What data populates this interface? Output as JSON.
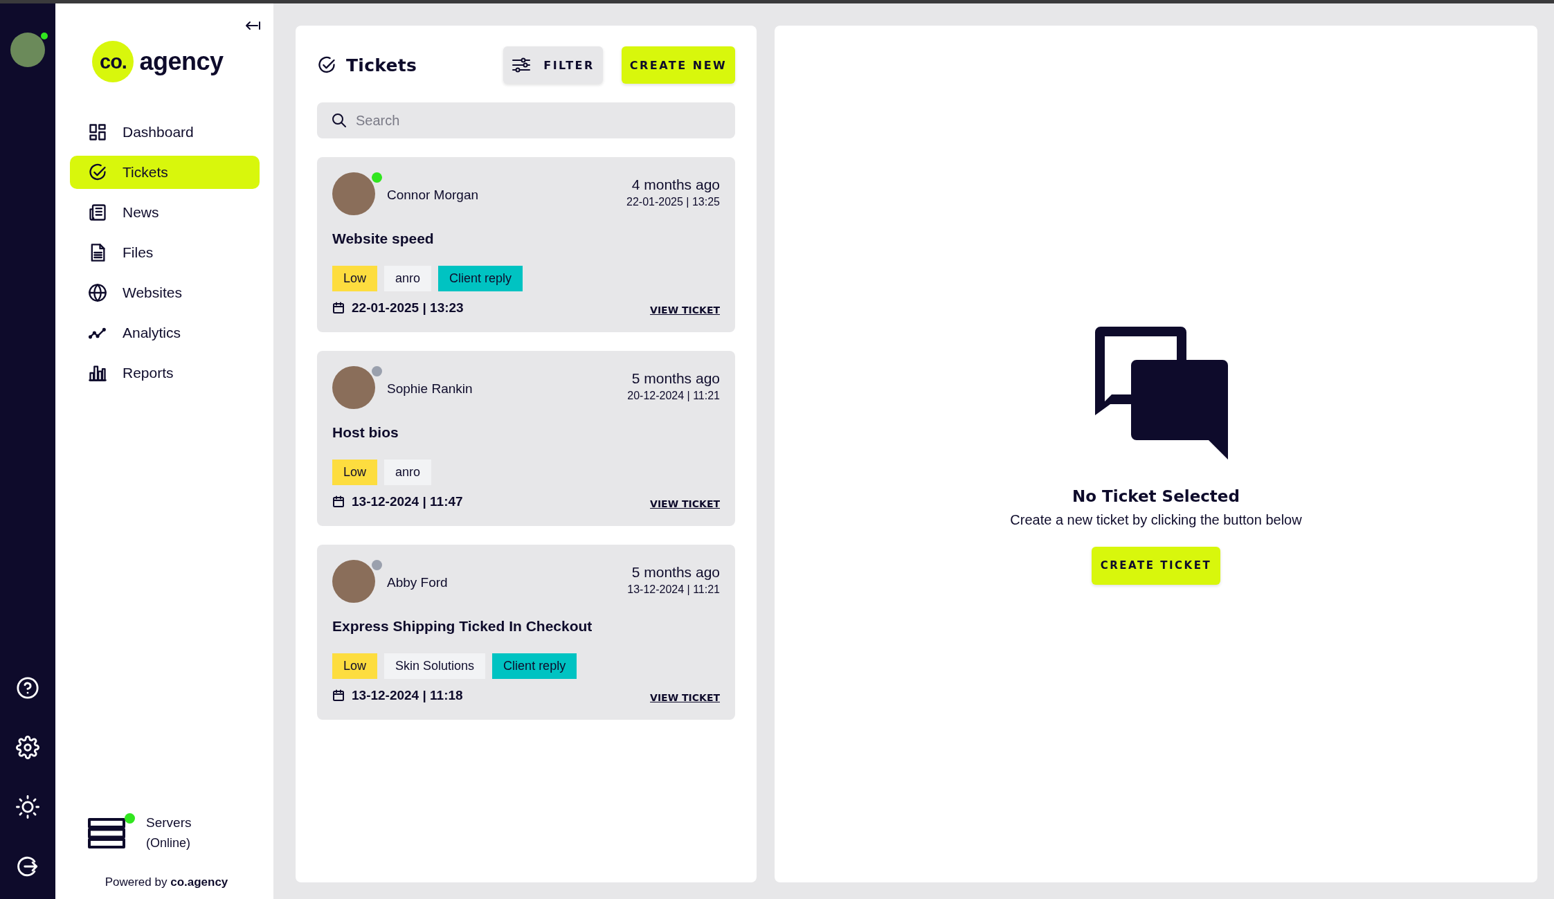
{
  "rail": {
    "user": {
      "online": true
    }
  },
  "sidebar": {
    "logo": {
      "mark": "co.",
      "word": "agency"
    },
    "nav": [
      {
        "label": "Dashboard",
        "selected": false
      },
      {
        "label": "Tickets",
        "selected": true
      },
      {
        "label": "News",
        "selected": false
      },
      {
        "label": "Files",
        "selected": false
      },
      {
        "label": "Websites",
        "selected": false
      },
      {
        "label": "Analytics",
        "selected": false
      },
      {
        "label": "Reports",
        "selected": false
      }
    ],
    "servers": {
      "label": "Servers",
      "status": "(Online)",
      "online": true
    },
    "powered_by": {
      "text": "Powered by",
      "brand": "co.agency"
    }
  },
  "tickets_panel": {
    "title": "Tickets",
    "filter_button": "FILTER",
    "create_button": "CREATE NEW",
    "search": {
      "placeholder": "Search"
    },
    "tickets": [
      {
        "user": "Connor Morgan",
        "online": true,
        "relative_time": "4 months ago",
        "timestamp": "22-01-2025 | 13:25",
        "title": "Website speed",
        "tags": [
          {
            "label": "Low",
            "color": "#fddd3f"
          },
          {
            "label": "anro",
            "color": "#f2f3f5"
          },
          {
            "label": "Client reply",
            "color": "#00c3c2"
          }
        ],
        "date": "22-01-2025 | 13:23",
        "link": "VIEW TICKET"
      },
      {
        "user": "Sophie Rankin",
        "online": false,
        "relative_time": "5 months ago",
        "timestamp": "20-12-2024 | 11:21",
        "title": "Host bios",
        "tags": [
          {
            "label": "Low",
            "color": "#fddd3f"
          },
          {
            "label": "anro",
            "color": "#f2f3f5"
          }
        ],
        "date": "13-12-2024 | 11:47",
        "link": "VIEW TICKET"
      },
      {
        "user": "Abby Ford",
        "online": false,
        "relative_time": "5 months ago",
        "timestamp": "13-12-2024 | 11:21",
        "title": "Express Shipping Ticked In Checkout",
        "tags": [
          {
            "label": "Low",
            "color": "#fddd3f"
          },
          {
            "label": "Skin Solutions",
            "color": "#f2f3f5"
          },
          {
            "label": "Client reply",
            "color": "#00c3c2"
          }
        ],
        "date": "13-12-2024 | 11:18",
        "link": "VIEW TICKET"
      }
    ]
  },
  "detail_panel": {
    "title": "No Ticket Selected",
    "message": "Create a new ticket by clicking the button below",
    "button": "CREATE TICKET"
  }
}
